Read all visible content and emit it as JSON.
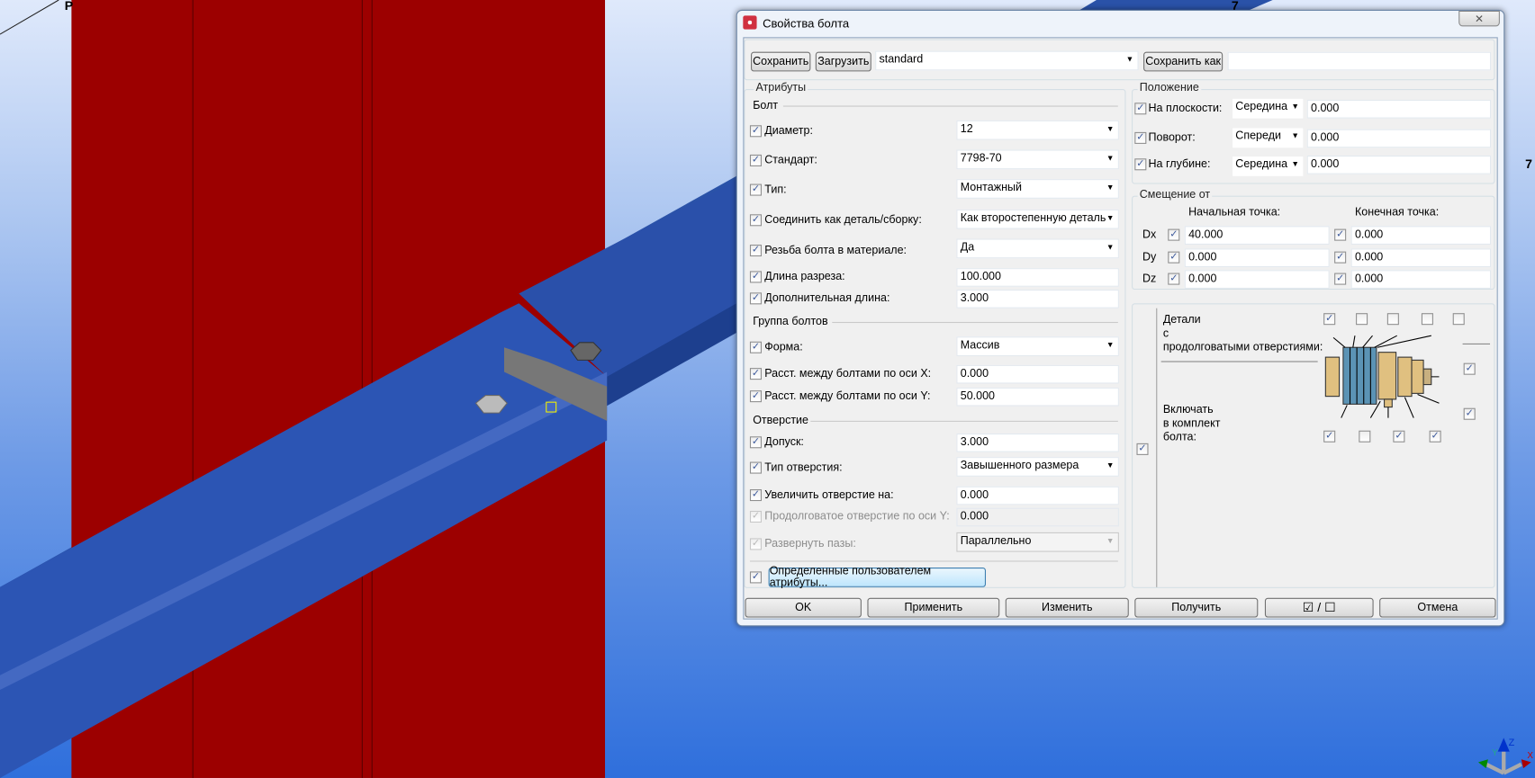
{
  "viewport": {
    "labels": [
      "P",
      "7",
      "7"
    ],
    "axes": {
      "x": "X",
      "y": "Y",
      "z": "Z"
    }
  },
  "dialog": {
    "title": "Свойства болта",
    "toolbar": {
      "save": "Сохранить",
      "load": "Загрузить",
      "preset": "standard",
      "save_as": "Сохранить как",
      "save_as_name": ""
    },
    "attributes": {
      "title": "Атрибуты",
      "bolt_header": "Болт",
      "diameter": {
        "label": "Диаметр:",
        "value": "12"
      },
      "standard": {
        "label": "Стандарт:",
        "value": "7798-70"
      },
      "type": {
        "label": "Тип:",
        "value": "Монтажный"
      },
      "connect_as": {
        "label": "Соединить как деталь/сборку:",
        "value": "Как второстепенную деталь"
      },
      "thread": {
        "label": "Резьба болта в материале:",
        "value": "Да"
      },
      "cut_length": {
        "label": "Длина разреза:",
        "value": "100.000"
      },
      "extra_length": {
        "label": "Дополнительная длина:",
        "value": "3.000"
      },
      "group_header": "Группа болтов",
      "shape": {
        "label": "Форма:",
        "value": "Массив"
      },
      "dist_x": {
        "label": "Расст. между болтами по оси X:",
        "value": "0.000"
      },
      "dist_y": {
        "label": "Расст. между болтами по оси Y:",
        "value": "50.000"
      },
      "hole_header": "Отверстие",
      "tolerance": {
        "label": "Допуск:",
        "value": "3.000"
      },
      "hole_type": {
        "label": "Тип отверстия:",
        "value": "Завышенного размера"
      },
      "enlarge": {
        "label": "Увеличить отверстие на:",
        "value": "0.000"
      },
      "slotted_y": {
        "label": "Продолговатое отверстие по оси Y:",
        "value": "0.000"
      },
      "rotate_slots": {
        "label": "Развернуть пазы:",
        "value": "Параллельно"
      },
      "user_attrs": "Определенные пользователем атрибуты..."
    },
    "position": {
      "title": "Положение",
      "on_plane": {
        "label": "На плоскости:",
        "option": "Середина",
        "value": "0.000"
      },
      "rotation": {
        "label": "Поворот:",
        "option": "Спереди",
        "value": "0.000"
      },
      "at_depth": {
        "label": "На глубине:",
        "option": "Середина",
        "value": "0.000"
      }
    },
    "offset": {
      "title": "Смещение от",
      "start": "Начальная точка:",
      "end": "Конечная точка:",
      "rows": [
        {
          "label": "Dx",
          "start": "40.000",
          "end": "0.000"
        },
        {
          "label": "Dy",
          "start": "0.000",
          "end": "0.000"
        },
        {
          "label": "Dz",
          "start": "0.000",
          "end": "0.000"
        }
      ]
    },
    "assembly": {
      "slotted_label_1": "Детали",
      "slotted_label_2": "с",
      "slotted_label_3": "продолговатыми отверстиями:",
      "include_1": "Включать",
      "include_2": "в комплект",
      "include_3": "болта:",
      "slotted_checks": [
        true,
        false,
        false,
        false,
        false
      ],
      "include_checks": [
        true,
        false,
        true,
        true
      ],
      "side_checks": [
        true,
        true
      ]
    },
    "buttons": {
      "ok": "OK",
      "apply": "Применить",
      "modify": "Изменить",
      "get": "Получить",
      "toggle": "☑ / ☐",
      "cancel": "Отмена"
    }
  }
}
